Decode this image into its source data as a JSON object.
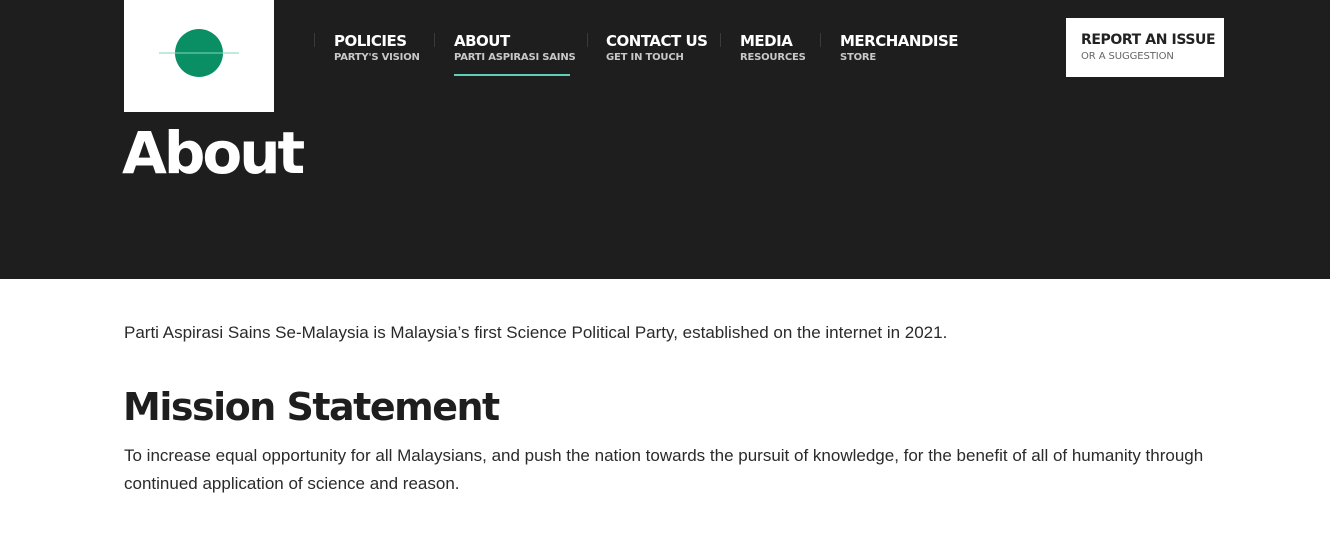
{
  "colors": {
    "hero_background": "#1e1e1e",
    "logo_green": "#0a8f64",
    "logo_line": "#7fd6c2",
    "nav_active_underline": "#5fd0b8",
    "text_dark": "#222222"
  },
  "logo": {
    "icon": "green-circle-logo"
  },
  "nav": [
    {
      "label": "POLICIES",
      "sub": "PARTY'S VISION"
    },
    {
      "label": "ABOUT",
      "sub": "PARTI ASPIRASI SAINS",
      "active": true
    },
    {
      "label": "CONTACT US",
      "sub": "GET IN TOUCH"
    },
    {
      "label": "MEDIA",
      "sub": "RESOURCES"
    },
    {
      "label": "MERCHANDISE",
      "sub": "STORE"
    }
  ],
  "report_button": {
    "label": "REPORT AN ISSUE",
    "sub": "OR A SUGGESTION"
  },
  "page_title": "About",
  "intro": "Parti Aspirasi Sains Se-Malaysia is Malaysia’s first Science Political Party, established on the internet in 2021.",
  "mission": {
    "heading": "Mission Statement",
    "body": "To increase equal opportunity for all Malaysians, and push the nation towards the pursuit of knowledge, for the benefit of all of humanity through continued application of science and reason."
  }
}
